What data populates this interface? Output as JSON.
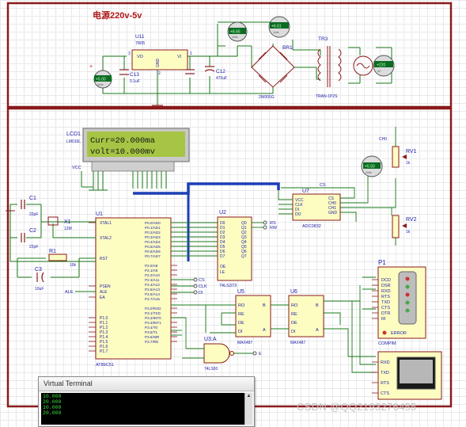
{
  "power_section": {
    "title": "电源220v-5v",
    "u11": {
      "ref": "U11",
      "part": "7805",
      "pin_vo": "VO",
      "pin_gnd": "GND",
      "pin_vi": "VI",
      "pin1": "1",
      "pin2": "2",
      "pin3": "3"
    },
    "c13": {
      "ref": "C13",
      "value": "0.1uF"
    },
    "c12": {
      "ref": "C12",
      "value": "470uF"
    },
    "br1": {
      "ref": "BR1",
      "part": "2W005G"
    },
    "tr3": {
      "ref": "TR3",
      "part": "TRAN-1P2S"
    },
    "meters": {
      "reading_a": "+5.00",
      "reading_b": "+8.65",
      "reading_c": "+6.61",
      "reading_d": "+220",
      "unit": "Volts",
      "reading_e": "AC"
    }
  },
  "lcd": {
    "ref": "LCD1",
    "model": "LM016L",
    "line1": "Curr=20.000ma",
    "line2": "volt=10.000mv",
    "vcc_label": "VCC"
  },
  "mcu": {
    "ref": "U1",
    "part": "AT89C51",
    "left_pins": [
      "XTAL1",
      "XTAL2",
      "RST",
      "PSEN",
      "ALE",
      "EA",
      "P1.0",
      "P1.1",
      "P1.2",
      "P1.3",
      "P1.4",
      "P1.5",
      "P1.6",
      "P1.7"
    ],
    "right_pins": [
      "P0.0/AD0",
      "P0.1/AD1",
      "P0.2/AD2",
      "P0.3/AD3",
      "P0.4/AD4",
      "P0.5/AD5",
      "P0.6/AD6",
      "P0.7/AD7",
      "P2.0/A8",
      "P2.1/A9",
      "P2.2/A10",
      "P2.3/A11",
      "P2.4/A12",
      "P2.5/A13",
      "P2.6/A14",
      "P2.7/A15",
      "P3.0/RXD",
      "P3.1/TXD",
      "P3.2/INT0",
      "P3.3/INT1",
      "P3.4/T0",
      "P3.5/T1",
      "P3.6/WR",
      "P3.7/RD"
    ],
    "ale_label": "ALE"
  },
  "crystal": {
    "c1": {
      "ref": "C1",
      "value": "22pF"
    },
    "c2": {
      "ref": "C2",
      "value": "22pF"
    },
    "x1": {
      "ref": "X1",
      "value": "12M"
    }
  },
  "reset": {
    "r1": {
      "ref": "R1",
      "value": "10k"
    },
    "c3": {
      "ref": "C3",
      "value": "10uF"
    }
  },
  "latch": {
    "ref": "U2",
    "part": "74LS373",
    "d_pins": [
      "D0",
      "D1",
      "D2",
      "D3",
      "D4",
      "D5",
      "D6",
      "D7"
    ],
    "q_pins": [
      "Q0",
      "Q1",
      "Q2",
      "Q3",
      "Q4",
      "Q5",
      "Q6",
      "Q7"
    ],
    "oe": "OE",
    "le": "LE",
    "rs": "RS",
    "rw": "RW"
  },
  "adc": {
    "ref": "U7",
    "part": "ADC0832",
    "pins_left": [
      "VCC",
      "CLK",
      "DI",
      "DO"
    ],
    "pins_right": [
      "CS",
      "CH0",
      "CH1",
      "GND"
    ],
    "cs_label": "CS",
    "net_cs": "CS",
    "net_clk": "CLK",
    "net_di": "DI"
  },
  "pots": {
    "rv1": {
      "ref": "RV1",
      "value": "1k",
      "ch": "CH0"
    },
    "rv2": {
      "ref": "RV2",
      "value": "1k"
    },
    "meter_reading": "+5.50"
  },
  "max_a": {
    "ref": "U5",
    "part": "MAX487",
    "pins": [
      "RO",
      "RE",
      "DE",
      "DI",
      "B",
      "A"
    ]
  },
  "max_b": {
    "ref": "U6",
    "part": "MAX487",
    "pins": [
      "RO",
      "RE",
      "DE",
      "DI",
      "B",
      "A"
    ]
  },
  "nand": {
    "ref": "U3:A",
    "part": "74LS00",
    "out_label": "E"
  },
  "rs232": {
    "ref": "P1",
    "part": "COMPIM",
    "pins": [
      "DCD",
      "DSR",
      "RXD",
      "RTS",
      "TXD",
      "CTS",
      "DTR",
      "RI"
    ],
    "error_label": "ERROR"
  },
  "terminal_pins": [
    "RXD",
    "TXD",
    "RTS",
    "CTS"
  ],
  "virtual_terminal": {
    "title": "Virtual Terminal",
    "lines": [
      "10.000",
      "20.000",
      "10.000",
      "20.000"
    ]
  },
  "watermark": "CSDN @QQ2193276455",
  "colors": {
    "border": "#8b1a1a",
    "wire": "#1a7a1a",
    "bus": "#1c3fb5",
    "component": "#8b1a1a",
    "fill": "#fdfdc2",
    "lcd_bg": "#a6c544",
    "text": "#1a1aa8",
    "meter_face": "#0c6c24"
  }
}
